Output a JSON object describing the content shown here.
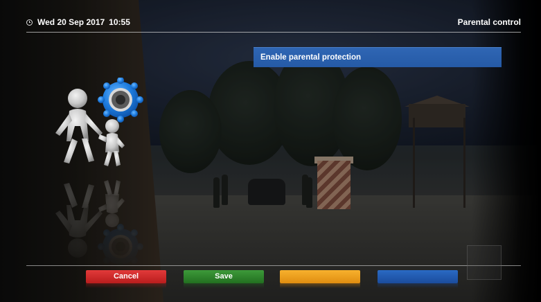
{
  "header": {
    "date": "Wed 20 Sep 2017",
    "time": "10:55",
    "title": "Parental control",
    "clock_icon": "clock-icon"
  },
  "side_icon": {
    "name": "parental-control-icon",
    "colors": {
      "figure": "#c9c9c9",
      "gear": "#1e7de0",
      "gear_center": "#5a5a5a"
    }
  },
  "menu": {
    "items": [
      {
        "label": "Enable parental protection",
        "selected": true
      }
    ],
    "highlight_color": "#2a60ad"
  },
  "footer": {
    "buttons": [
      {
        "label": "Cancel",
        "color": "#d02b2b"
      },
      {
        "label": "Save",
        "color": "#2f8a2d"
      },
      {
        "label": "",
        "color": "#f0a020"
      },
      {
        "label": "",
        "color": "#2360b8"
      }
    ]
  }
}
